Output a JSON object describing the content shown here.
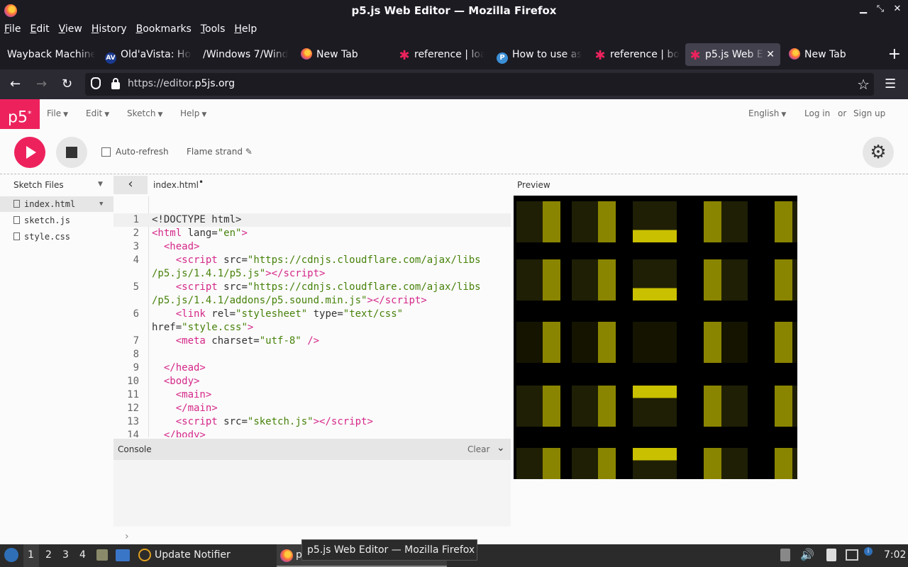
{
  "window": {
    "title": "p5.js Web Editor — Mozilla Firefox",
    "min": "▁",
    "max": "⤡",
    "close": "✕"
  },
  "menubar": [
    "File",
    "Edit",
    "View",
    "History",
    "Bookmarks",
    "Tools",
    "Help"
  ],
  "tabs": [
    {
      "label": "Wayback Machine",
      "icon": "archive-icon"
    },
    {
      "label": "Old'aVista: Ho",
      "icon": "altavista-icon"
    },
    {
      "label": "/Windows 7/Wind",
      "icon": "none"
    },
    {
      "label": "New Tab",
      "icon": "firefox-icon"
    },
    {
      "label": "reference | loa",
      "icon": "p5-star-icon"
    },
    {
      "label": "How to use as",
      "icon": "p-icon"
    },
    {
      "label": "reference | bo",
      "icon": "p5-star-icon"
    },
    {
      "label": "p5.js Web E",
      "icon": "p5-star-icon",
      "active": true
    },
    {
      "label": "New Tab",
      "icon": "firefox-icon"
    }
  ],
  "newtab_label": "+",
  "url": {
    "prefix": "https://editor.",
    "domain": "p5js.org"
  },
  "p5": {
    "logo": "p5",
    "logo_sup": "*",
    "menus": [
      "File",
      "Edit",
      "Sketch",
      "Help"
    ],
    "language": "English",
    "login": "Log in",
    "or": "or",
    "signup": "Sign up",
    "autorefresh": "Auto-refresh",
    "sketch_name": "Flame strand",
    "pencil": "✎",
    "sketch_files": "Sketch Files",
    "files": [
      "index.html",
      "sketch.js",
      "style.css"
    ],
    "open_file": "index.html",
    "unsaved_dot": "•",
    "preview": "Preview",
    "console": "Console",
    "clear": "Clear",
    "console_prompt": "›"
  },
  "code_lines": [
    {
      "n": "1",
      "html": "<span>&lt;!DOCTYPE html&gt;</span>"
    },
    {
      "n": "2",
      "html": "<span class='tag'>&lt;html</span> lang=<span class='str'>\"en\"</span><span class='tag'>&gt;</span>"
    },
    {
      "n": "3",
      "html": "  <span class='tag'>&lt;head&gt;</span>"
    },
    {
      "n": "4",
      "html": "    <span class='tag'>&lt;script</span> src=<span class='str'>\"https://cdnjs.cloudflare.com/ajax/libs</span>"
    },
    {
      "n": "",
      "html": "<span class='str'>/p5.js/1.4.1/p5.js\"</span><span class='tag'>&gt;&lt;/script&gt;</span>"
    },
    {
      "n": "5",
      "html": "    <span class='tag'>&lt;script</span> src=<span class='str'>\"https://cdnjs.cloudflare.com/ajax/libs</span>"
    },
    {
      "n": "",
      "html": "<span class='str'>/p5.js/1.4.1/addons/p5.sound.min.js\"</span><span class='tag'>&gt;&lt;/script&gt;</span>"
    },
    {
      "n": "6",
      "html": "    <span class='tag'>&lt;link</span> rel=<span class='str'>\"stylesheet\"</span> type=<span class='str'>\"text/css\"</span>"
    },
    {
      "n": "",
      "html": "href=<span class='str'>\"style.css\"</span><span class='tag'>&gt;</span>"
    },
    {
      "n": "7",
      "html": "    <span class='tag'>&lt;meta</span> charset=<span class='str'>\"utf-8\"</span> <span class='tag'>/&gt;</span>"
    },
    {
      "n": "8",
      "html": ""
    },
    {
      "n": "9",
      "html": "  <span class='tag'>&lt;/head&gt;</span>"
    },
    {
      "n": "10",
      "html": "  <span class='tag'>&lt;body&gt;</span>"
    },
    {
      "n": "11",
      "html": "    <span class='tag'>&lt;main&gt;</span>"
    },
    {
      "n": "12",
      "html": "    <span class='tag'>&lt;/main&gt;</span>"
    },
    {
      "n": "13",
      "html": "    <span class='tag'>&lt;script</span> src=<span class='str'>\"sketch.js\"</span><span class='tag'>&gt;&lt;/script&gt;</span>"
    },
    {
      "n": "14",
      "html": "  <span class='tag'>&lt;/body&gt;</span>"
    }
  ],
  "taskbar": {
    "workspaces": [
      "1",
      "2",
      "3",
      "4"
    ],
    "update_notifier": "Update Notifier",
    "firefox_task": "p",
    "tooltip": "p5.js Web Editor — Mozilla Firefox",
    "clock": "7:02"
  },
  "colors": {
    "p5_pink": "#ed225d",
    "cube_yellow": "#b3b000"
  }
}
